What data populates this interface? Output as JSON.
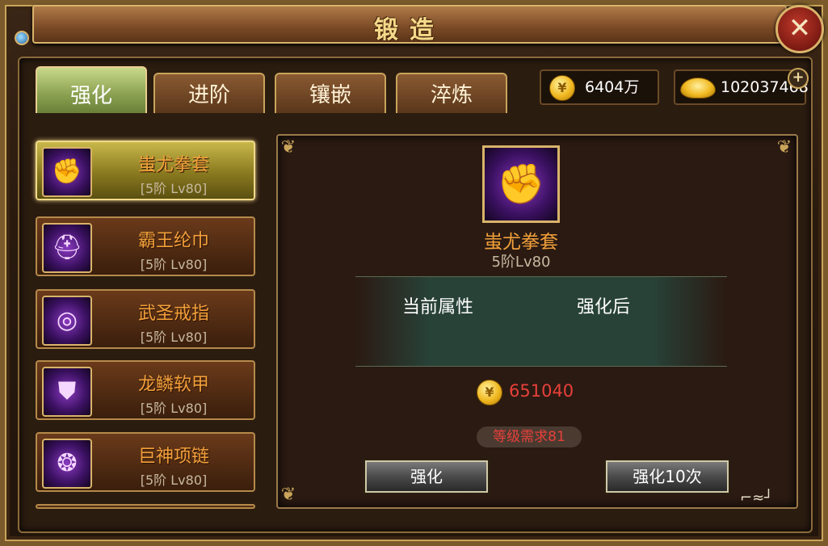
{
  "title": "锻造",
  "close_glyph": "✕",
  "tabs": [
    {
      "label": "强化",
      "active": true
    },
    {
      "label": "进阶",
      "active": false
    },
    {
      "label": "镶嵌",
      "active": false
    },
    {
      "label": "淬炼",
      "active": false
    }
  ],
  "currency": {
    "gold": {
      "icon": "gold-coin-icon",
      "value": "6404万"
    },
    "ingot": {
      "icon": "gold-ingot-icon",
      "value": "102037468"
    },
    "add_glyph": "+"
  },
  "equipment_list": [
    {
      "name": "蚩尤拳套",
      "level": "[5阶 Lv80]",
      "icon": "gauntlet-icon",
      "selected": true
    },
    {
      "name": "霸王纶巾",
      "level": "[5阶 Lv80]",
      "icon": "helmet-icon",
      "selected": false
    },
    {
      "name": "武圣戒指",
      "level": "[5阶 Lv80]",
      "icon": "ring-icon",
      "selected": false
    },
    {
      "name": "龙鳞软甲",
      "level": "[5阶 Lv80]",
      "icon": "armor-icon",
      "selected": false
    },
    {
      "name": "巨神项链",
      "level": "[5阶 Lv80]",
      "icon": "necklace-icon",
      "selected": false
    }
  ],
  "detail": {
    "item_name": "蚩尤拳套",
    "item_level": "5阶Lv80",
    "current_attr_label": "当前属性",
    "after_label": "强化后",
    "cost": "651040",
    "requirement": "等级需求81",
    "enhance_button": "强化",
    "enhance10_button": "强化10次"
  },
  "colors": {
    "item_name": "#f2a03a",
    "cost": "#e8403a",
    "frame_gold": "#c9a45a"
  }
}
